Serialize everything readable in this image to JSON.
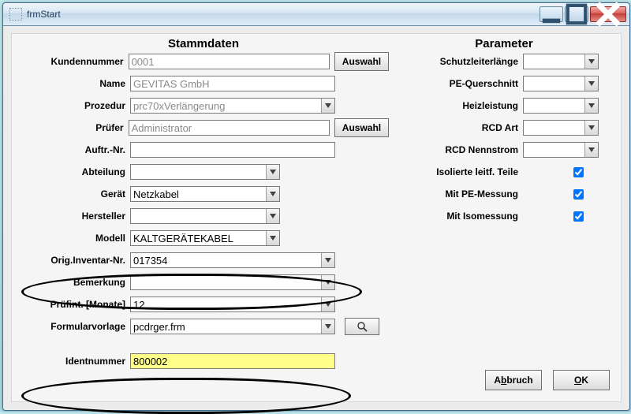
{
  "window": {
    "title": "frmStart"
  },
  "headings": {
    "left": "Stammdaten",
    "right": "Parameter"
  },
  "labels": {
    "kundennummer": "Kundennummer",
    "name": "Name",
    "prozedur": "Prozedur",
    "pruefer": "Prüfer",
    "auftrnr": "Auftr.-Nr.",
    "abteilung": "Abteilung",
    "geraet": "Gerät",
    "hersteller": "Hersteller",
    "modell": "Modell",
    "originv": "Orig.Inventar-Nr.",
    "bemerkung": "Bemerkung",
    "pruefint": "Prüfint. [Monate]",
    "formular": "Formularvorlage",
    "ident": "Identnummer",
    "schutzleiter": "Schutzleiterlänge",
    "pequerschnitt": "PE-Querschnitt",
    "heizleistung": "Heizleistung",
    "rcdart": "RCD Art",
    "rcdnennstrom": "RCD Nennstrom",
    "isolierte": "Isolierte  leitf. Teile",
    "mitpe": "Mit PE-Messung",
    "mitiso": "Mit Isomessung"
  },
  "values": {
    "kundennummer": "0001",
    "name": "GEVITAS GmbH",
    "prozedur": "prc70xVerlängerung",
    "pruefer": "Administrator",
    "auftrnr": "",
    "abteilung": "",
    "geraet": "Netzkabel",
    "hersteller": "",
    "modell": "KALTGERÄTEKABEL",
    "originv": "017354",
    "bemerkung": "",
    "pruefint": "12",
    "formular": "pcdrger.frm",
    "ident": "800002",
    "schutzleiter": "",
    "pequerschnitt": "",
    "heizleistung": "",
    "rcdart": "",
    "rcdnennstrom": ""
  },
  "checks": {
    "isolierte": true,
    "mitpe": true,
    "mitiso": true
  },
  "buttons": {
    "auswahl": "Auswahl",
    "abbruch_pre": "A",
    "abbruch_u": "b",
    "abbruch_post": "bruch",
    "ok_pre": "",
    "ok_u": "O",
    "ok_post": "K"
  }
}
